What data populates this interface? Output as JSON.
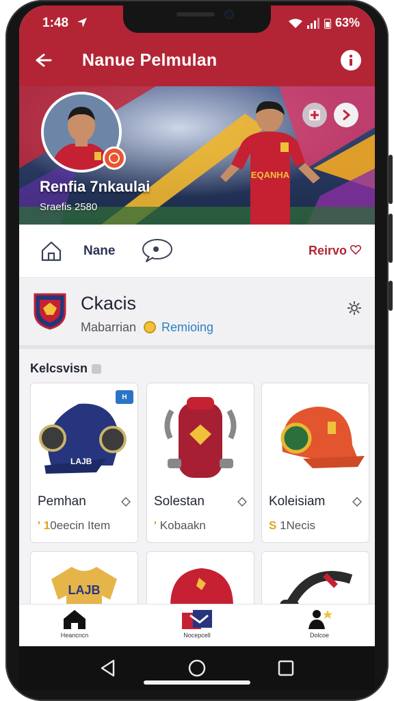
{
  "status_bar": {
    "time": "1:48",
    "battery": "63%"
  },
  "app_bar": {
    "title": "Nanue Pelmulan"
  },
  "hero": {
    "player_name": "Renfia 7nkaulai",
    "player_subtitle": "Sraefis 2580",
    "jersey_text": "EQANHA"
  },
  "nav": {
    "home_label": "Nane",
    "right_label": "Reirvo"
  },
  "club": {
    "title": "Ckacis",
    "subtitle": "Mabarrian",
    "link": "Remioing"
  },
  "collection": {
    "heading": "Kelcsvisn",
    "items": [
      {
        "title": "Pemhan",
        "prefix": "' 1",
        "sub": "0eecin Item",
        "tag": "H",
        "icon": "cap-blue-headphones"
      },
      {
        "title": "Solestan",
        "prefix": "'",
        "sub": " Kobaakn",
        "icon": "backpack-red"
      },
      {
        "title": "Koleisiam",
        "prefix": "S",
        "sub": " 1Necis",
        "icon": "cap-orange-headphones"
      },
      {
        "title": "",
        "prefix": "",
        "sub": "",
        "icon": "shirt-yellow"
      },
      {
        "title": "",
        "prefix": "",
        "sub": "",
        "icon": "cap-red"
      },
      {
        "title": "",
        "prefix": "",
        "sub": "",
        "icon": "headphones-dark"
      }
    ]
  },
  "bottom_nav": [
    {
      "label": "Heancncn",
      "icon": "home-icon"
    },
    {
      "label": "Nocepcell",
      "icon": "shop-icon"
    },
    {
      "label": "Dolcoe",
      "icon": "player-icon"
    }
  ],
  "colors": {
    "brand_red": "#b32535",
    "navy": "#2c3354",
    "link_blue": "#2d7fc1",
    "gold": "#e4a21a"
  }
}
